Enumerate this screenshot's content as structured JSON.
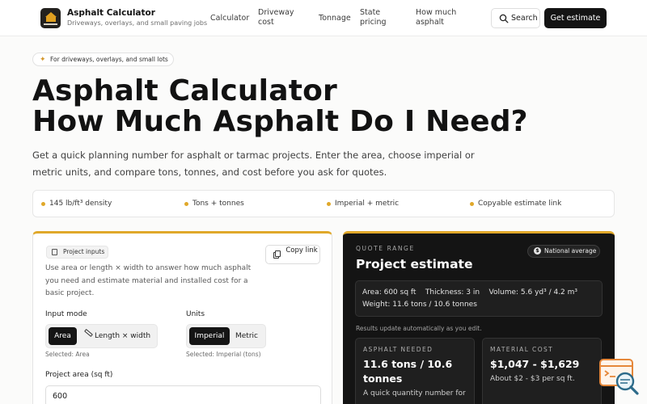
{
  "header": {
    "brand_title": "Asphalt Calculator",
    "brand_subtitle": "Driveways, overlays, and small paving jobs",
    "nav": [
      "Calculator",
      "Driveway cost",
      "Tonnage",
      "State pricing",
      "How much asphalt"
    ],
    "search_label": "Search",
    "cta_label": "Get estimate"
  },
  "hero": {
    "pill": "For driveways, overlays, and small lots",
    "title_line1": "Asphalt Calculator",
    "title_line2": "How Much Asphalt Do I Need?",
    "lede": "Get a quick planning number for asphalt or tarmac projects. Enter the area, choose imperial or metric units, and compare tons, tonnes, and cost before you ask for quotes."
  },
  "features": [
    "145 lb/ft³ density",
    "Tons + tonnes",
    "Imperial + metric",
    "Copyable estimate link"
  ],
  "inputs_card": {
    "tag": "Project inputs",
    "copy_label": "Copy link",
    "description": "Use area or length × width to answer how much asphalt you need and estimate material and installed cost for a basic project.",
    "input_mode": {
      "label": "Input mode",
      "options": [
        "Area",
        "Length × width"
      ],
      "selected_hint": "Selected: Area"
    },
    "units": {
      "label": "Units",
      "options": [
        "Imperial",
        "Metric"
      ],
      "selected_hint": "Selected: Imperial (tons)"
    },
    "area_label": "Project area (sq ft)",
    "area_value": "600"
  },
  "estimate_card": {
    "kicker": "QUOTE RANGE",
    "badge": "National average",
    "title": "Project estimate",
    "summary_area": "Area: 600 sq ft",
    "summary_thickness": "Thickness: 3 in",
    "summary_volume": "Volume: 5.6 yd³ / 4.2 m³",
    "summary_weight": "Weight: 11.6 tons / 10.6 tonnes",
    "update_note": "Results update automatically as you edit.",
    "asphalt_needed": {
      "label": "ASPHALT NEEDED",
      "value": "11.6 tons / 10.6 tonnes",
      "note": "A quick quantity number for"
    },
    "material_cost": {
      "label": "MATERIAL COST",
      "value": "$1,047 - $1,629",
      "note": "About $2 - $3 per sq ft."
    }
  },
  "colors": {
    "accent": "#e0a82a",
    "dark": "#141414",
    "widget": "#e5873a"
  }
}
